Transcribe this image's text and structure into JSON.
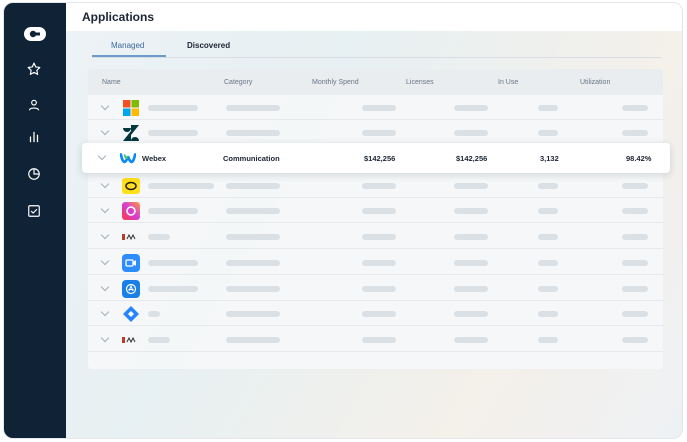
{
  "header": {
    "title": "Applications"
  },
  "tabs": [
    {
      "label": "Managed",
      "active": true
    },
    {
      "label": "Discovered",
      "active": false
    }
  ],
  "table": {
    "columns": [
      "Name",
      "Category",
      "Monthly Spend",
      "Licenses",
      "In Use",
      "Utilization"
    ],
    "highlighted_row": {
      "name": "Webex",
      "category": "Communication",
      "monthly_spend": "$142,256",
      "licenses": "$142,256",
      "in_use": "3,132",
      "utilization": "98.42%"
    },
    "row_logos": [
      "microsoft-logo",
      "zendesk-logo",
      "webex-logo",
      "mailchimp-logo",
      "adobe-cc-logo",
      "miro-logo",
      "zoom-logo",
      "appstore-logo",
      "jira-logo",
      "miro-logo"
    ]
  },
  "sidebar": {
    "icons": [
      "star-icon",
      "user-icon",
      "bar-chart-icon",
      "pie-chart-icon",
      "checklist-icon"
    ]
  },
  "colors": {
    "sidebar": "#0f2236",
    "accent": "#3d6a9e"
  }
}
